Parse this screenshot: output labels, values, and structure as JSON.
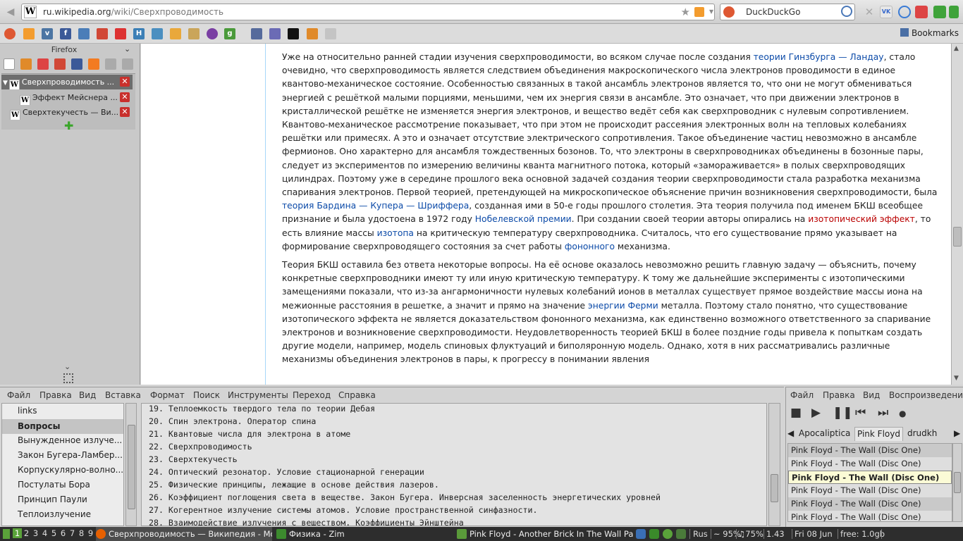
{
  "browser": {
    "url_domain": "ru.wikipedia.org",
    "url_path": "/wiki/Сверхпроводимость",
    "search_engine": "DuckDuckGo",
    "sidebar_title": "Firefox",
    "bookmarks_label": "Bookmarks",
    "tabs": [
      {
        "label": "Сверхпроводимость ..."
      },
      {
        "label": "Эффект Мейснера ..."
      },
      {
        "label": "Сверхтекучесть — Ви..."
      }
    ]
  },
  "article": {
    "p1": {
      "s1": "Уже на относительно ранней стадии изучения сверхпроводимости, во всяком случае после создания ",
      "l1": "теории Гинзбурга — Ландау",
      "s2": ", стало очевидно, что сверхпроводимость является следствием объединения макроскопического числа электронов проводимости в единое квантово-механическое состояние. Особенностью связанных в такой ансамбль электронов является то, что они не могут обмениваться энергией с решёткой малыми порциями, меньшими, чем их энергия связи в ансамбле. Это означает, что при движении электронов в кристаллической решётке не изменяется энергия электронов, и вещество ведёт себя как сверхпроводник с нулевым сопротивлением. Квантово-механическое рассмотрение показывает, что при этом не происходит рассеяния электронных волн на тепловых колебаниях решётки или примесях. А это и означает отсутствие электрического сопротивления. Такое объединение частиц невозможно в ансамбле фермионов. Оно характерно для ансамбля тождественных бозонов. То, что электроны в сверхпроводниках объединены в бозонные пары, следует из экспериментов по измерению величины кванта магнитного потока, который «замораживается» в полых сверхпроводящих цилиндрах. Поэтому уже в середине прошлого века основной задачей создания теории сверхпроводимости стала разработка механизма спаривания электронов. Первой теорией, претендующей на микроскопическое объяснение причин возникновения сверхпроводимости, была ",
      "l2": "теория Бардина — Купера — Шриффера",
      "s3": ", созданная ими в 50-е годы прошлого столетия. Эта теория получила под именем БКШ всеобщее признание и была удостоена в 1972 году ",
      "l3": "Нобелевской премии",
      "s4": ". При создании своей теории авторы опирались на ",
      "l4": "изотопический эффект",
      "s5": ", то есть влияние массы ",
      "l5": "изотопа",
      "s6": " на критическую температуру сверхпроводника. Считалось, что его существование прямо указывает на формирование сверхпроводящего состояния за счет работы ",
      "l6": "фононного",
      "s7": " механизма."
    },
    "p2": {
      "s1": "Теория БКШ оставила без ответа некоторые вопросы. На её основе оказалось невозможно решить главную задачу — объяснить, почему конкретные сверхпроводники имеют ту или иную критическую температуру. К тому же дальнейшие эксперименты с изотопическими замещениями показали, что из-за ангармоничности нулевых колебаний ионов в металлах существует прямое воздействие массы иона на межионные расстояния в решетке, а значит и прямо на значение ",
      "l1": "энергии Ферми",
      "s2": " металла. Поэтому стало понятно, что существование изотопического эффекта не является доказательством фононного механизма, как единственно возможного ответственного за спаривание электронов и возникновение сверхпроводимости. Неудовлетворенность теорией БКШ в более поздние годы привела к попыткам создать другие модели, например, модель спиновых флуктуаций и биполяронную модель. Однако, хотя в них рассматривались различные механизмы объединения электронов в пары, к прогрессу в понимании явления"
    }
  },
  "zim": {
    "menu": [
      "Файл",
      "Правка",
      "Вид",
      "Вставка",
      "Формат",
      "Поиск",
      "Инструменты",
      "Переход",
      "Справка"
    ],
    "index": [
      "links",
      "Вопросы",
      "Вынужденное излуче...",
      "Закон Бугера-Ламбер...",
      "Корпускулярно-волно...",
      "Постулаты Бора",
      "Принцип Паули",
      "Теплоизлучение"
    ],
    "lines": [
      "19. Теплоемкость твердого тела по теории Дебая",
      "20. Спин электрона. Оператор спина",
      "21. Квантовые числа для электрона в атоме",
      "22. Сверхпроводимость",
      "23. Сверхтекучесть",
      "24. Оптический резонатор. Условие стационарной генерации",
      "25. Физические принципы, лежащие в основе действия лазеров.",
      "26. Коэффициент поглощения света в веществе. Закон Бугера. Инверсная заселенность энергетических уровней",
      "27. Когерентное излучение системы атомов. Условие пространственной синфазности.",
      "28. Взаимодействие излучения с веществом. Коэффициенты Эйнштейна"
    ]
  },
  "player": {
    "menu": [
      "Файл",
      "Правка",
      "Вид",
      "Воспроизведение"
    ],
    "tabs": [
      "Apocaliptica",
      "Pink Floyd",
      "drudkh"
    ],
    "tracks": [
      "Pink Floyd - The Wall (Disc One)",
      "Pink Floyd - The Wall (Disc One)",
      "Pink Floyd - The Wall (Disc One)",
      "Pink Floyd - The Wall (Disc One)",
      "Pink Floyd - The Wall (Disc One)",
      "Pink Floyd - The Wall (Disc One)"
    ]
  },
  "taskbar": {
    "workspaces": [
      "1",
      "2",
      "3",
      "4",
      "5",
      "6",
      "7",
      "8",
      "9"
    ],
    "tasks": [
      "Сверхпроводимость — Википедия - Mo...",
      "Физика - Zim",
      "Pink Floyd - Another Brick In The Wall Par..."
    ],
    "keyboard_layout": "Rus",
    "battery": "~ 95%",
    "volume": "♫75%",
    "cpu_temp": "1.43",
    "date": "Fri 08 Jun",
    "free_mem": "free: 1.0gb"
  },
  "colors": {
    "link": "#0b4aa8",
    "redlink": "#ba0000",
    "taskbar_bg": "#2d2d2d",
    "workspace_active": "#5aa23a"
  }
}
